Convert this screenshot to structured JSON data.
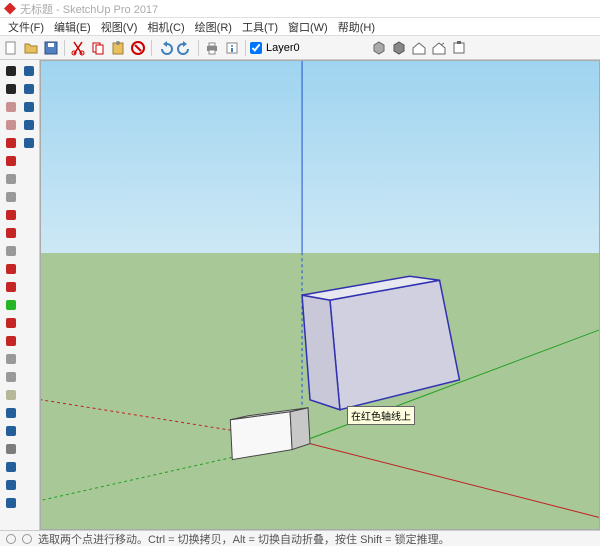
{
  "app": {
    "title": "无标题 - SketchUp Pro 2017"
  },
  "menu": {
    "items": [
      {
        "label": "文件(F)"
      },
      {
        "label": "编辑(E)"
      },
      {
        "label": "视图(V)"
      },
      {
        "label": "相机(C)"
      },
      {
        "label": "绘图(R)"
      },
      {
        "label": "工具(T)"
      },
      {
        "label": "窗口(W)"
      },
      {
        "label": "帮助(H)"
      }
    ]
  },
  "toolbar": {
    "layer_checked": true,
    "layer_label": "Layer0",
    "buttons": [
      {
        "name": "new-icon"
      },
      {
        "name": "open-icon"
      },
      {
        "name": "save-icon"
      },
      {
        "name": "sep"
      },
      {
        "name": "cut-icon"
      },
      {
        "name": "copy-icon"
      },
      {
        "name": "paste-icon"
      },
      {
        "name": "delete-icon"
      },
      {
        "name": "sep"
      },
      {
        "name": "undo-icon"
      },
      {
        "name": "redo-icon"
      },
      {
        "name": "sep"
      },
      {
        "name": "print-icon"
      },
      {
        "name": "model-info-icon"
      },
      {
        "name": "sep"
      }
    ],
    "right_buttons": [
      {
        "name": "component-icon"
      },
      {
        "name": "warehouse-icon"
      },
      {
        "name": "house-icon"
      },
      {
        "name": "share-icon"
      },
      {
        "name": "extension-icon"
      }
    ]
  },
  "sidetools": {
    "items": [
      {
        "name": "select-icon",
        "color": "#000"
      },
      {
        "name": "lasso-icon",
        "color": "#000"
      },
      {
        "name": "eraser-icon",
        "color": "#c08080"
      },
      {
        "name": "paint-icon",
        "color": "#c08080"
      },
      {
        "name": "line-icon",
        "color": "#b00"
      },
      {
        "name": "freehand-icon",
        "color": "#b00"
      },
      {
        "name": "rectangle-icon",
        "color": "#888"
      },
      {
        "name": "circle-icon",
        "color": "#888"
      },
      {
        "name": "arc-icon",
        "color": "#b00"
      },
      {
        "name": "arc2-icon",
        "color": "#b00"
      },
      {
        "name": "pushpull-icon",
        "color": "#888"
      },
      {
        "name": "offset-icon",
        "color": "#b00"
      },
      {
        "name": "move-icon",
        "color": "#b00"
      },
      {
        "name": "rotate-icon",
        "color": "#0a0"
      },
      {
        "name": "followme-icon",
        "color": "#b00"
      },
      {
        "name": "scale-icon",
        "color": "#b00"
      },
      {
        "name": "tape-icon",
        "color": "#888"
      },
      {
        "name": "protractor-icon",
        "color": "#888"
      },
      {
        "name": "dimension-icon",
        "color": "#aa8"
      },
      {
        "name": "text-icon",
        "color": "#048"
      },
      {
        "name": "axes-icon",
        "color": "#048"
      },
      {
        "name": "section-icon",
        "color": "#666"
      },
      {
        "name": "orbit-icon",
        "color": "#048"
      },
      {
        "name": "pan-icon",
        "color": "#048"
      },
      {
        "name": "zoom-icon",
        "color": "#048"
      },
      {
        "name": "zoomwin-icon",
        "color": "#048"
      },
      {
        "name": "position-icon",
        "color": "#048"
      },
      {
        "name": "lookaround-icon",
        "color": "#048"
      },
      {
        "name": "walk-icon",
        "color": "#048"
      },
      {
        "name": "3dtext-icon",
        "color": "#048"
      }
    ]
  },
  "viewport": {
    "tooltip": "在红色轴线上"
  },
  "status": {
    "hint": "选取两个点进行移动。Ctrl = 切换拷贝，Alt = 切换自动折叠，按住 Shift = 锁定推理。"
  }
}
